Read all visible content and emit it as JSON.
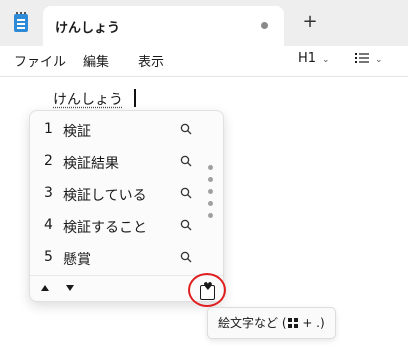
{
  "tab": {
    "title": "けんしょう",
    "new_tab_glyph": "+"
  },
  "menu": {
    "file": "ファイル",
    "edit": "編集",
    "view": "表示"
  },
  "toolbar": {
    "heading": "H1"
  },
  "editor": {
    "text": "けんしょう"
  },
  "ime": {
    "candidates": [
      {
        "num": "1",
        "text": "検証"
      },
      {
        "num": "2",
        "text": "検証結果"
      },
      {
        "num": "3",
        "text": "検証している"
      },
      {
        "num": "4",
        "text": "検証すること"
      },
      {
        "num": "5",
        "text": "懸賞"
      }
    ]
  },
  "tooltip": {
    "prefix": "絵文字など (",
    "suffix": " + .)"
  },
  "colors": {
    "highlight": "#e02020",
    "app_icon": "#2f8ad8"
  }
}
